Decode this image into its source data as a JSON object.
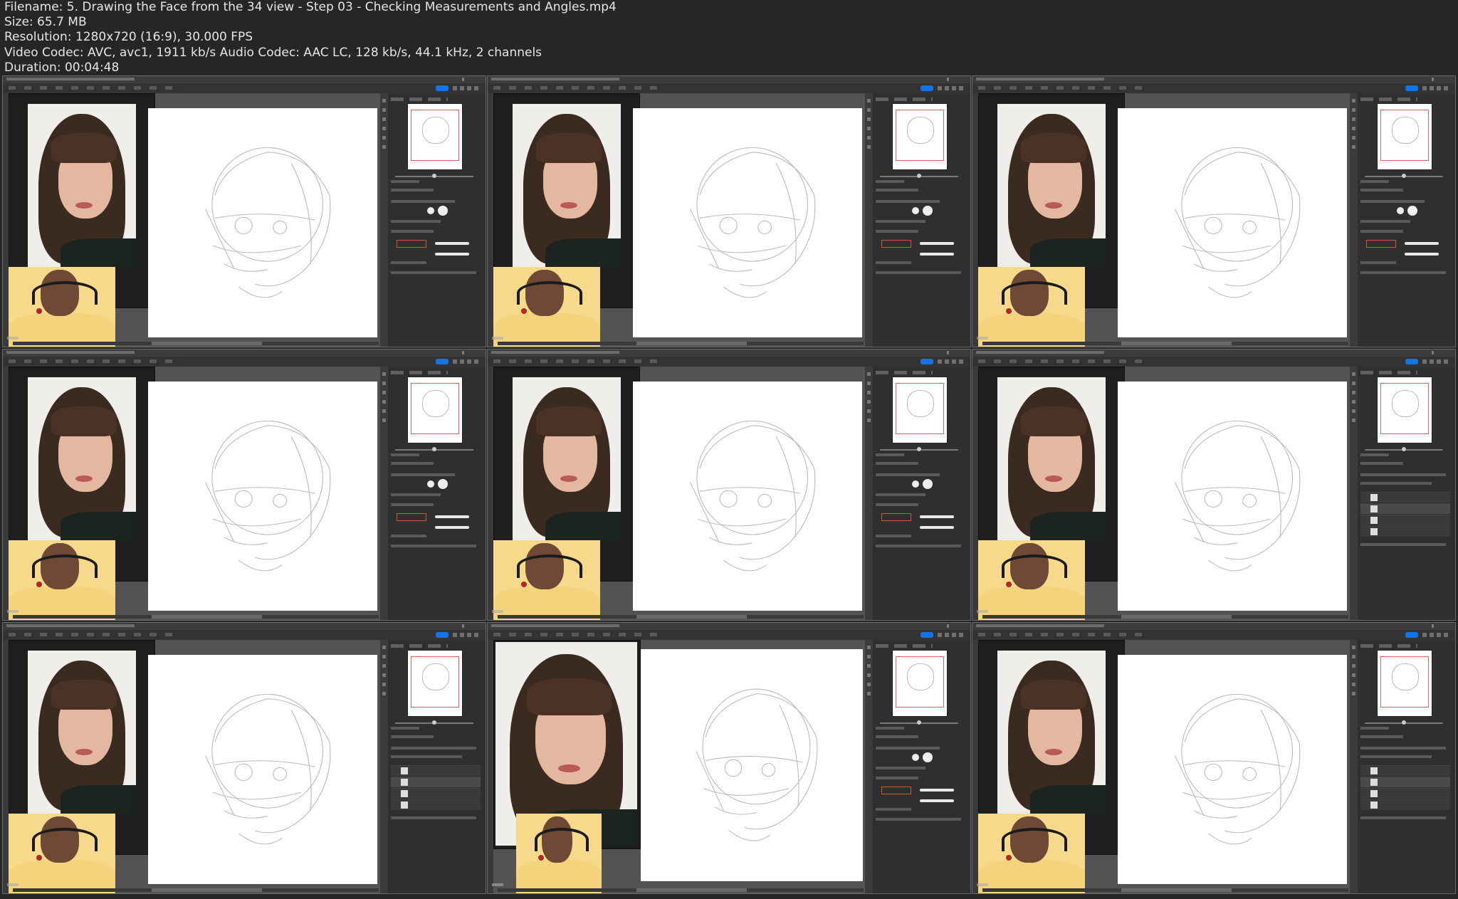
{
  "header": {
    "filename": "Filename: 5. Drawing the Face from the 34 view - Step 03 - Checking Measurements and Angles.mp4",
    "size": "Size: 65.7 MB",
    "resolution": "Resolution: 1280x720 (16:9), 30.000 FPS",
    "codec": "Video Codec: AVC, avc1, 1911 kb/s Audio Codec: AAC LC, 128 kb/s, 44.1 kHz, 2 channels",
    "duration": "Duration: 00:04:48"
  },
  "colors": {
    "background": "#262626",
    "panel": "#2f2f2f",
    "workspace": "#535353",
    "share_button": "#1473e6",
    "selection_red": "#d24a4a"
  },
  "icons": [
    "dot-menu-icon",
    "share-button",
    "window-controls-icon"
  ],
  "thumbnails": [
    {
      "panel_mode": "brushes",
      "reference_style": "normal"
    },
    {
      "panel_mode": "brushes",
      "reference_style": "normal"
    },
    {
      "panel_mode": "brushes",
      "reference_style": "normal"
    },
    {
      "panel_mode": "brushes",
      "reference_style": "normal"
    },
    {
      "panel_mode": "brushes",
      "reference_style": "normal"
    },
    {
      "panel_mode": "layers",
      "reference_style": "normal"
    },
    {
      "panel_mode": "layers",
      "reference_style": "normal"
    },
    {
      "panel_mode": "brushes",
      "reference_style": "zoomed"
    },
    {
      "panel_mode": "layers",
      "reference_style": "normal"
    }
  ]
}
